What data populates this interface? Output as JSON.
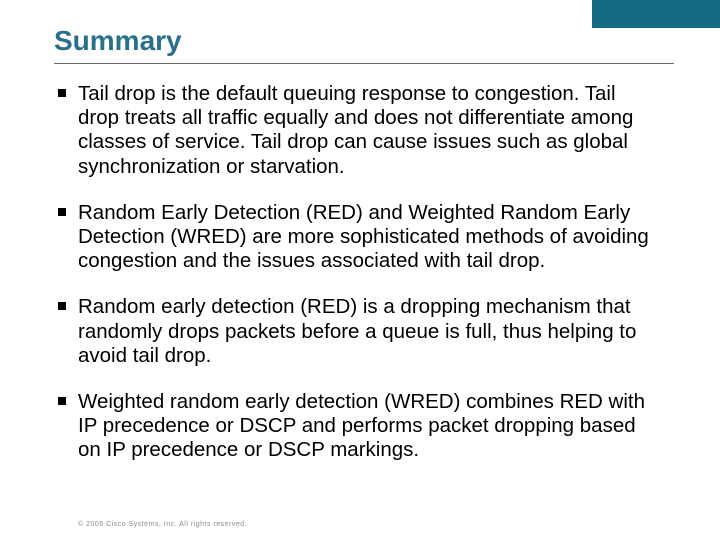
{
  "accent_color": "#136b85",
  "title": "Summary",
  "bullets": [
    "Tail drop is the default queuing response to congestion. Tail drop treats all traffic equally and does not differentiate among classes of service. Tail drop can cause issues such as global synchronization or starvation.",
    "Random Early Detection (RED) and Weighted Random Early Detection (WRED) are more sophisticated methods of avoiding congestion and the issues associated with tail drop.",
    "Random early detection (RED) is a dropping mechanism that randomly drops packets before a queue is full, thus helping to avoid tail drop.",
    "Weighted random early detection (WRED) combines RED with IP precedence or DSCP and performs packet dropping based on IP precedence or DSCP markings."
  ],
  "footer": "© 2006 Cisco Systems, Inc. All rights reserved."
}
